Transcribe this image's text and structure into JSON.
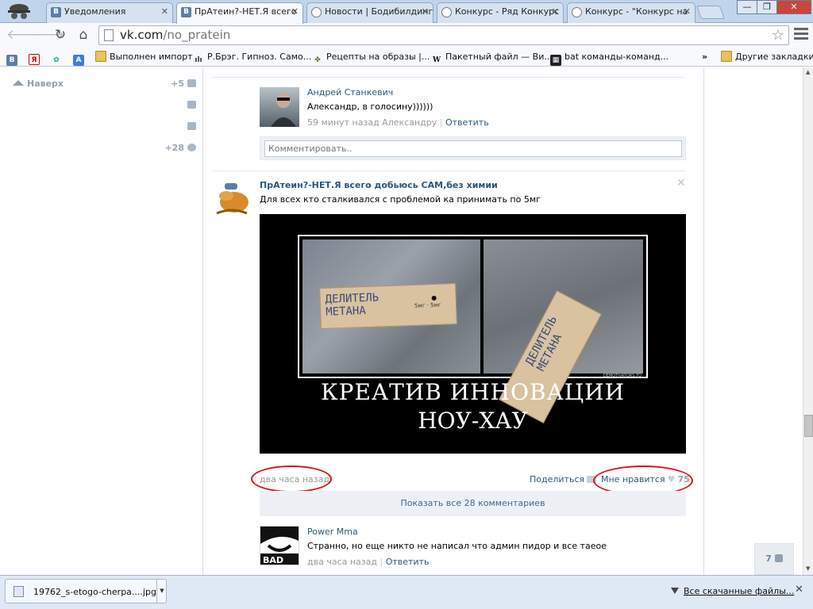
{
  "browser": {
    "tabs": [
      {
        "label": "Уведомления",
        "favicon": "В"
      },
      {
        "label": "ПрАтеин?-НЕТ.Я всего",
        "favicon": "В"
      },
      {
        "label": "Новости | Бодибилдинг",
        "favicon": ""
      },
      {
        "label": "Конкурс - Ряд Конкурс",
        "favicon": ""
      },
      {
        "label": "Конкурс - \"Конкурс на",
        "favicon": ""
      }
    ],
    "url_host": "vk.com",
    "url_path": "/no_pratein",
    "window_buttons": {
      "minimize": "—",
      "restore": "❐",
      "close": "✕"
    }
  },
  "bookmarks": [
    {
      "label": "",
      "icon": "В"
    },
    {
      "label": "",
      "icon": "Я"
    },
    {
      "label": "",
      "icon": "✿"
    },
    {
      "label": "",
      "icon": "A"
    },
    {
      "label": "Выполнен импорт",
      "icon": "folder"
    },
    {
      "label": "Р.Брэг. Гипноз. Само...",
      "icon": "ılı"
    },
    {
      "label": "Рецепты на образы |...",
      "icon": "✤"
    },
    {
      "label": "Пакетный файл — Ви...",
      "icon": "W"
    },
    {
      "label": "bat команды-команд...",
      "icon": "▦"
    }
  ],
  "bookmarks_more": "»",
  "bookmarks_other": "Другие закладки",
  "left_nav": {
    "up_label": "Наверх",
    "friends_count": "+5",
    "settings_count": "+28"
  },
  "comment1": {
    "author": "Андрей Станкевич",
    "text": "Александр, в голосину))))))",
    "time": "59 минут назад Александру",
    "reply": "Ответить"
  },
  "comment_input": {
    "placeholder": "Комментировать.."
  },
  "post": {
    "group": "ПрАтеин?-НЕТ.Я всего добьюсь САМ,без химии",
    "text": "Для всех кто сталкивался с проблемой ка принимать по 5мг",
    "image": {
      "board_text_1": "ДЕЛИТЕЛЬ\nМЕТАНА",
      "board_text_2": "ДЕЛИТЕЛЬ\nМЕТАНА",
      "scale_label": "5мг · 5мг",
      "watermark": "DEMOTIVATORS.TO",
      "caption_line1": "КРЕАТИВ  ИННОВАЦИИ",
      "caption_line2": "НОУ-ХАУ"
    },
    "time": "два часа назад",
    "share_label": "Поделиться",
    "like_label": "Мне нравится",
    "like_count": "75",
    "show_all_comments": "Показать все 28 комментариев",
    "close": "✕"
  },
  "comment2": {
    "author": "Power Mma",
    "text": "Странно, но еще никто не написал что админ пидор и все таеое",
    "time": "два часа назад",
    "reply": "Ответить"
  },
  "online_count": "7",
  "downloads": {
    "file_name": "19762_s-etogo-cherpa....jpg",
    "all_label": "Все скачанные файлы...",
    "close": "✕"
  }
}
